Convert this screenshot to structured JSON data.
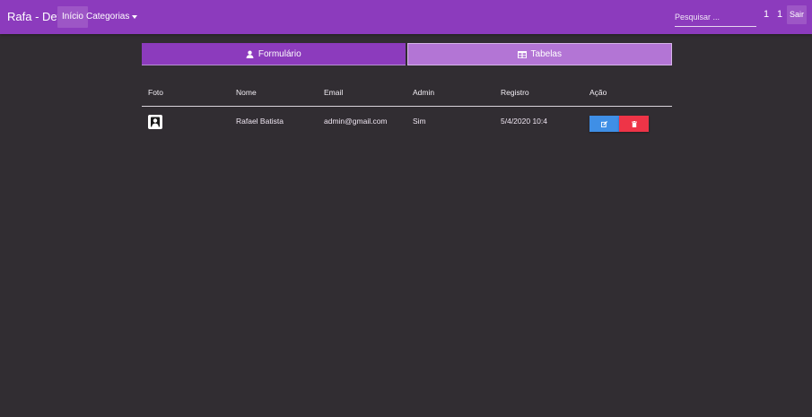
{
  "navbar": {
    "brand": "Rafa - Dev",
    "home": "Início",
    "categories": "Categorias",
    "search_placeholder": "Pesquisar ...",
    "count_a": "1",
    "count_b": "1",
    "logout": "Sair"
  },
  "tabs": [
    {
      "label": "Formulário",
      "icon": "user-icon"
    },
    {
      "label": "Tabelas",
      "icon": "table-icon"
    }
  ],
  "table": {
    "columns": [
      "Foto",
      "Nome",
      "Email",
      "Admin",
      "Registro",
      "Ação"
    ],
    "rows": [
      {
        "photo_icon": "user-avatar-icon",
        "name": "Rafael Batista",
        "email": "admin@gmail.com",
        "admin": "Sim",
        "registered": "5/4/2020 10:4",
        "actions": [
          "edit-icon",
          "trash-icon"
        ]
      }
    ]
  },
  "colors": {
    "accent": "#8c3bbd",
    "background": "#312d32",
    "edit": "#3f8fe6",
    "delete": "#ee3447"
  }
}
